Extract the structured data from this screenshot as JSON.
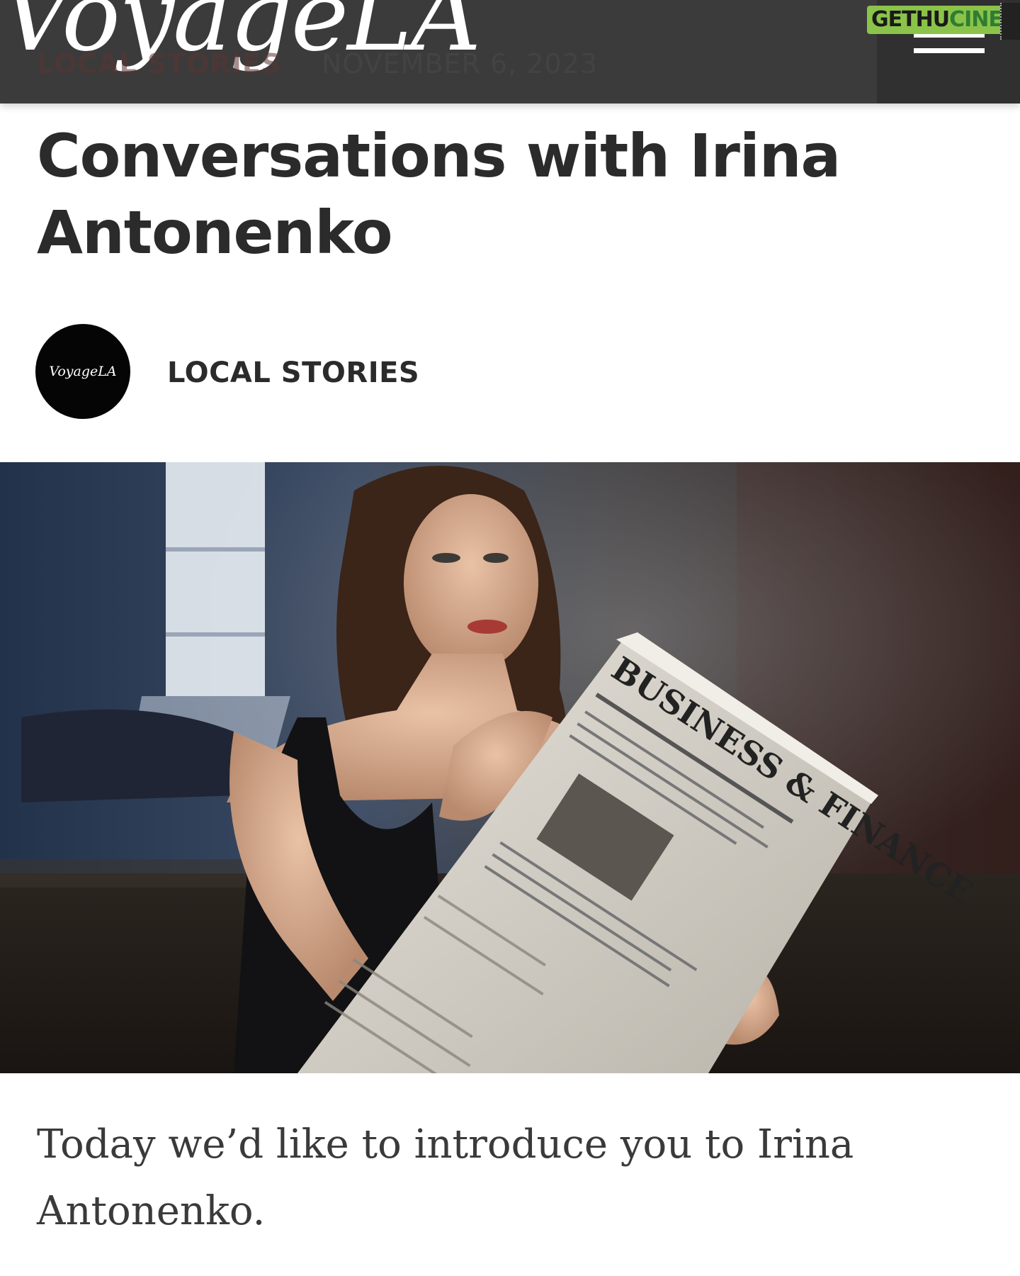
{
  "header": {
    "logo_text": "VoyageLA",
    "category_label": "LOCAL STORIES",
    "date": "NOVEMBER 6, 2023",
    "watermark_part1": "GETHU",
    "watermark_part2": "CINEMA"
  },
  "article": {
    "title": "Conversations with Irina Antonenko",
    "author_avatar_text": "VoyageLA",
    "category_link": "LOCAL STORIES",
    "hero_image_alt": "Irina Antonenko",
    "newspaper_headline": "BUSINESS & FINANCE",
    "intro": "Today we’d like to introduce you to Irina Antonenko."
  },
  "icons": {
    "menu": "hamburger-menu-icon",
    "watermark": "film-strip-icon"
  },
  "colors": {
    "header_bg": "#3b3b3b",
    "title": "#2b2b2b",
    "body_text": "#3a3a3a",
    "watermark_green": "#8bc34a"
  }
}
